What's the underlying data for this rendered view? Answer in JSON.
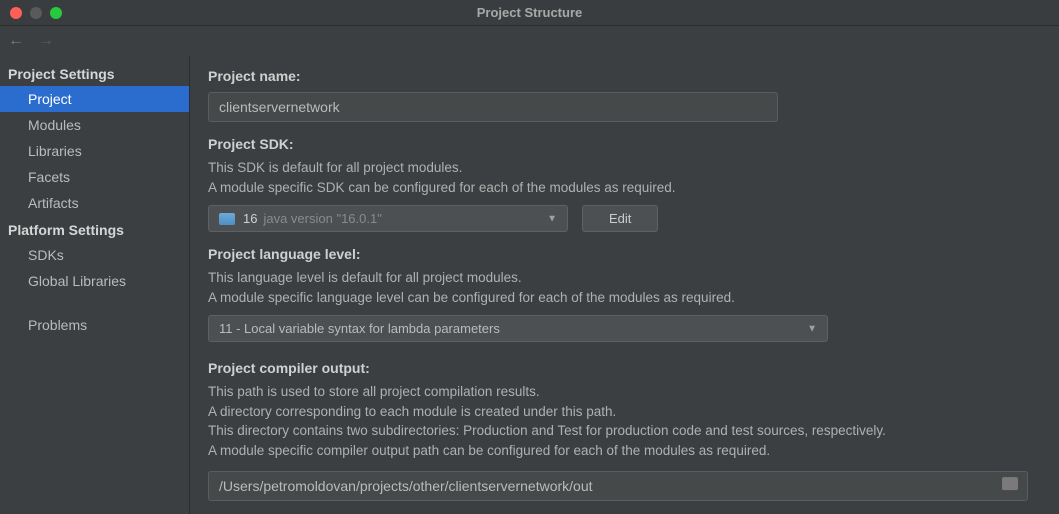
{
  "title": "Project Structure",
  "sidebar": {
    "projectSettings": {
      "heading": "Project Settings",
      "items": [
        {
          "label": "Project",
          "selected": true
        },
        {
          "label": "Modules"
        },
        {
          "label": "Libraries"
        },
        {
          "label": "Facets"
        },
        {
          "label": "Artifacts"
        }
      ]
    },
    "platformSettings": {
      "heading": "Platform Settings",
      "items": [
        {
          "label": "SDKs"
        },
        {
          "label": "Global Libraries"
        }
      ]
    },
    "bottom": {
      "items": [
        {
          "label": "Problems"
        }
      ]
    }
  },
  "content": {
    "projectName": {
      "label": "Project name:",
      "value": "clientservernetwork"
    },
    "projectSdk": {
      "label": "Project SDK:",
      "desc1": "This SDK is default for all project modules.",
      "desc2": "A module specific SDK can be configured for each of the modules as required.",
      "selectedPrimary": "16",
      "selectedSecondary": "java version \"16.0.1\"",
      "editLabel": "Edit"
    },
    "languageLevel": {
      "label": "Project language level:",
      "desc1": "This language level is default for all project modules.",
      "desc2": "A module specific language level can be configured for each of the modules as required.",
      "selected": "11 - Local variable syntax for lambda parameters"
    },
    "compilerOutput": {
      "label": "Project compiler output:",
      "desc1": "This path is used to store all project compilation results.",
      "desc2": "A directory corresponding to each module is created under this path.",
      "desc3": "This directory contains two subdirectories: Production and Test for production code and test sources, respectively.",
      "desc4": "A module specific compiler output path can be configured for each of the modules as required.",
      "value": "/Users/petromoldovan/projects/other/clientservernetwork/out"
    }
  }
}
